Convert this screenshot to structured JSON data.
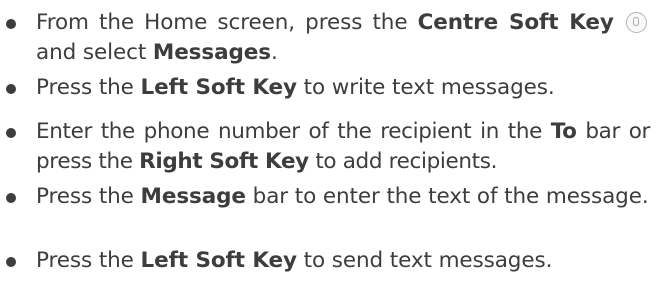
{
  "items": [
    {
      "seg1": "From the Home screen, press the ",
      "b1": "Centre Soft Key",
      "icon": "microphone-key-icon",
      "seg2": " and select ",
      "b2": "Messages",
      "seg3": "."
    },
    {
      "seg1": "Press the ",
      "b1": "Left Soft Key",
      "seg2": " to write text messages."
    },
    {
      "seg1": "Enter the phone number of the recipient in the ",
      "b1": "To",
      "seg2": " bar or press the ",
      "b2": "Right Soft Key",
      "seg3": " to add recipients."
    },
    {
      "seg1": "Press the ",
      "b1": "Message",
      "seg2": " bar to enter the text of the message."
    },
    {
      "seg1": "Press the ",
      "b1": "Left Soft Key",
      "seg2": " to send text messages."
    }
  ]
}
